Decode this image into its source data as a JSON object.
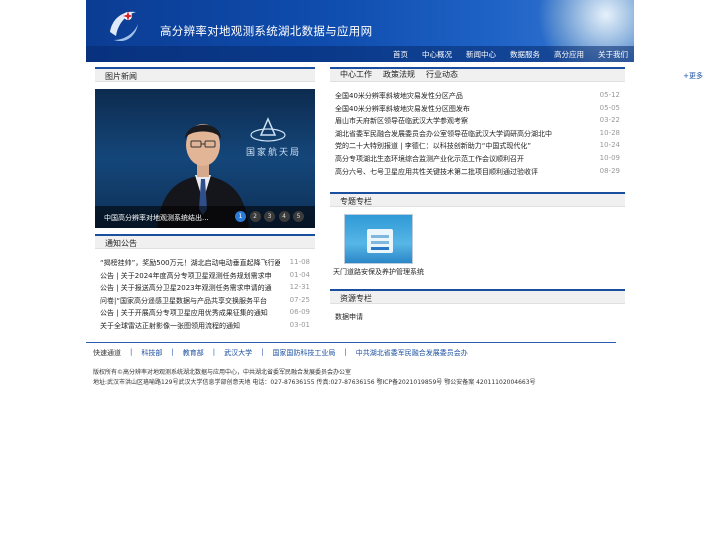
{
  "site": {
    "title": "高分辨率对地观测系统湖北数据与应用网"
  },
  "nav": [
    "首页",
    "中心概况",
    "新闻中心",
    "数据服务",
    "高分应用",
    "关于我们"
  ],
  "photo_news": {
    "title": "图片新闻",
    "background_text": "国家航天局",
    "caption": "中国高分辨率对地观测系统结出...",
    "pages": [
      "1",
      "2",
      "3",
      "4",
      "5"
    ],
    "active_page": 1
  },
  "center_work": {
    "tabs": [
      "中心工作",
      "政策法规",
      "行业动态"
    ],
    "more": "+更多",
    "items": [
      {
        "title": "全国40米分辨率斜坡地灾易发性分区产品",
        "date": "05-12"
      },
      {
        "title": "全国40米分辨率斜坡地灾易发性分区图发布",
        "date": "05-05"
      },
      {
        "title": "眉山市天府新区领导莅临武汉大学参观考察",
        "date": "03-22"
      },
      {
        "title": "湖北省委军民融合发展委员会办公室领导莅临武汉大学调研高分湖北中",
        "date": "10-28"
      },
      {
        "title": "党的二十大特别报道 | 李德仁：以科技创新助力“中国式现代化”",
        "date": "10-24"
      },
      {
        "title": "高分专项湖北生态环境综合监测产业化示范工作会议顺利召开",
        "date": "10-09"
      },
      {
        "title": "高分六号、七号卫星应用共性关键技术第二批项目顺利通过验收评",
        "date": "08-29"
      }
    ]
  },
  "notices": {
    "title": "通知公告",
    "items": [
      {
        "title": "“揭榜挂帅”，奖励500万元！湖北启动电动垂直起降飞行器",
        "date": "11-08"
      },
      {
        "title": "公告 | 关于2024年度高分专项卫星观测任务规划需求申",
        "date": "01-04"
      },
      {
        "title": "公告 | 关于报送高分卫星2023年观测任务需求申请的通",
        "date": "12-31"
      },
      {
        "title": "问卷|“国家高分遥感卫星数据与产品共享交换服务平台",
        "date": "07-25"
      },
      {
        "title": "公告 | 关于开展高分专项卫星应用优秀成果征集的通知",
        "date": "06-09"
      },
      {
        "title": "关于全球雷达正射影像一张图领用流程的通知",
        "date": "03-01"
      }
    ]
  },
  "projects": {
    "title": "专题专栏",
    "item": "天门道路安保及养护管理系统"
  },
  "resources": {
    "title": "资源专栏",
    "item": "数据申请"
  },
  "quick_links": {
    "label": "快速通道",
    "links": [
      "科技部",
      "教育部",
      "武汉大学",
      "国家国防科技工业局",
      "中共湖北省委军民融合发展委员会办"
    ]
  },
  "footer": {
    "line1": "版权所有©高分辨率对地观测系统湖北数据与应用中心，中共湖北省委军民融合发展委员会办公室",
    "line2": "地址:武汉市洪山区珞喻路129号武汉大学信息学部创意天地 电话：027-87636155 传真:027-87636156 鄂ICP备2021019859号 鄂公安备案 42011102004663号"
  },
  "colors": {
    "header_blue": "#0f4dae",
    "accent": "#1a4fa0",
    "active_dot": "#2b7bd6"
  }
}
